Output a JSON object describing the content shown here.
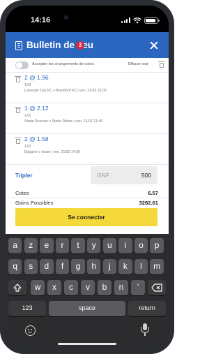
{
  "status_bar": {
    "time": "14:16"
  },
  "header": {
    "title": "Bulletin de Jeu",
    "badge_count": "3",
    "accent_color": "#2b67c0"
  },
  "options": {
    "accept_changes_label": "Accepter les changements de cotes",
    "accept_changes_enabled": false,
    "clear_all_label": "Effacer tout"
  },
  "bets": [
    {
      "pick": "2 @ 1.96",
      "market": "1X2",
      "match": "Leicester City FC v Brentford FC | ven. 21/02 22:00"
    },
    {
      "pick": "1 @ 2.12",
      "market": "1X2",
      "match": "Stade Rennais v Stade Reims | ven. 21/02 21:45"
    },
    {
      "pick": "2 @ 1.58",
      "market": "1X2",
      "match": "Bulgarie v Israel | ven. 21/02 14:30"
    }
  ],
  "stake": {
    "tripler_label": "Tripler",
    "currency": "GNF",
    "amount": "500"
  },
  "summary": {
    "odds_label": "Cotes",
    "odds_value": "6.57",
    "gains_label": "Gains Possibles",
    "gains_value": "3282.61"
  },
  "connect_button": {
    "label": "Se connecter",
    "color": "#f5d93a"
  },
  "keyboard": {
    "row1": [
      "a",
      "z",
      "e",
      "r",
      "t",
      "y",
      "u",
      "i",
      "o",
      "p"
    ],
    "row2": [
      "q",
      "s",
      "d",
      "f",
      "g",
      "h",
      "j",
      "k",
      "l",
      "m"
    ],
    "row3": [
      "w",
      "x",
      "c",
      "v",
      "b",
      "n",
      "'"
    ],
    "numbers_label": "123",
    "space_label": "space",
    "return_label": "return"
  }
}
